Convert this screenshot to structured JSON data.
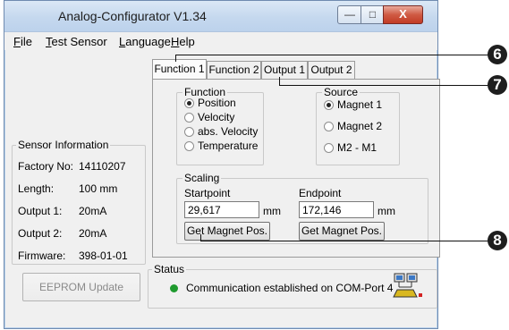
{
  "window": {
    "title": "Analog-Configurator V1.34"
  },
  "caption_buttons": {
    "min": "—",
    "max": "□",
    "close": "X"
  },
  "menu": [
    {
      "text": "File",
      "accel": "F",
      "rest": "ile"
    },
    {
      "text": "Test Sensor",
      "accel": "T",
      "rest": "est Sensor"
    },
    {
      "text": "Language",
      "accel": "L",
      "rest": "anguage"
    },
    {
      "text": "Help",
      "accel": "H",
      "rest": "elp"
    }
  ],
  "tabs": [
    "Function 1",
    "Function 2",
    "Output 1",
    "Output 2"
  ],
  "function_group": {
    "legend": "Function",
    "options": [
      "Position",
      "Velocity",
      "abs. Velocity",
      "Temperature"
    ],
    "selected_index": 0
  },
  "source_group": {
    "legend": "Source",
    "options": [
      "Magnet 1",
      "Magnet 2",
      "M2 - M1"
    ],
    "selected_index": 0
  },
  "scaling": {
    "legend": "Scaling",
    "start_label": "Startpoint",
    "start_value": "29,617",
    "start_unit": "mm",
    "end_label": "Endpoint",
    "end_value": "172,146",
    "end_unit": "mm",
    "button_label": "Get Magnet Pos."
  },
  "sensor_info": {
    "legend": "Sensor Information",
    "rows": [
      {
        "label": "Factory No:",
        "value": "14110207"
      },
      {
        "label": "Length:",
        "value": "100 mm"
      },
      {
        "label": "Output 1:",
        "value": "20mA"
      },
      {
        "label": "Output 2:",
        "value": "20mA"
      },
      {
        "label": "Firmware:",
        "value": "398-01-01"
      }
    ]
  },
  "eeprom_button": "EEPROM Update",
  "status": {
    "legend": "Status",
    "message": "Communication established on COM-Port 4",
    "indicator_color": "#1f9a2e",
    "icon": "network-computers-icon"
  },
  "callouts": [
    "6",
    "7",
    "8"
  ]
}
